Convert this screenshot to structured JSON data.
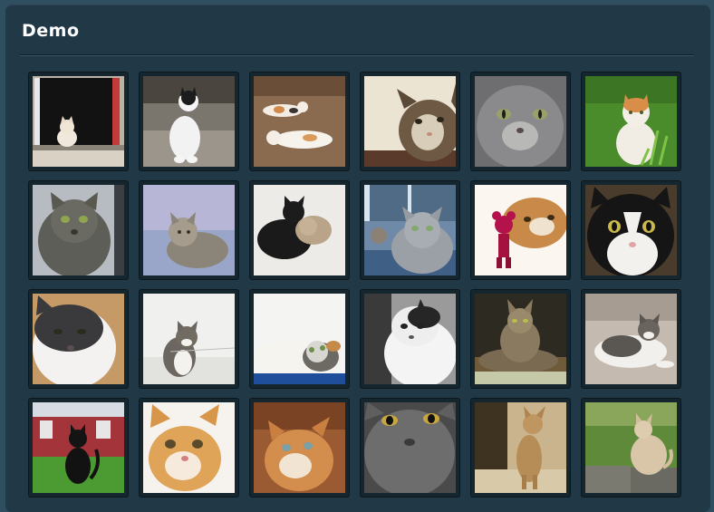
{
  "panel": {
    "title": "Demo"
  },
  "gallery": {
    "items": [
      {
        "icon": "cat-in-window-photo"
      },
      {
        "icon": "black-white-cat-sitting-photo"
      },
      {
        "icon": "two-cats-lying-photo"
      },
      {
        "icon": "tabby-cat-closeup-photo"
      },
      {
        "icon": "grey-cat-face-photo"
      },
      {
        "icon": "orange-white-cat-grass-photo"
      },
      {
        "icon": "grey-tabby-cat-photo"
      },
      {
        "icon": "fluffy-cat-sky-photo"
      },
      {
        "icon": "black-cat-cuddling-photo"
      },
      {
        "icon": "grey-cat-window-photo"
      },
      {
        "icon": "cat-with-toy-photo"
      },
      {
        "icon": "black-white-kitten-face-photo"
      },
      {
        "icon": "black-white-cat-closeup-photo"
      },
      {
        "icon": "kitten-playing-string-photo"
      },
      {
        "icon": "kitten-lying-photo"
      },
      {
        "icon": "white-cat-bw-photo"
      },
      {
        "icon": "maine-coon-cat-photo"
      },
      {
        "icon": "cat-lying-bed-photo"
      },
      {
        "icon": "black-cat-red-house-photo"
      },
      {
        "icon": "orange-kitten-photo"
      },
      {
        "icon": "orange-cat-looking-up-photo"
      },
      {
        "icon": "grey-cat-golden-eyes-photo"
      },
      {
        "icon": "tabby-cat-standing-photo"
      },
      {
        "icon": "cat-on-wall-photo"
      }
    ]
  }
}
